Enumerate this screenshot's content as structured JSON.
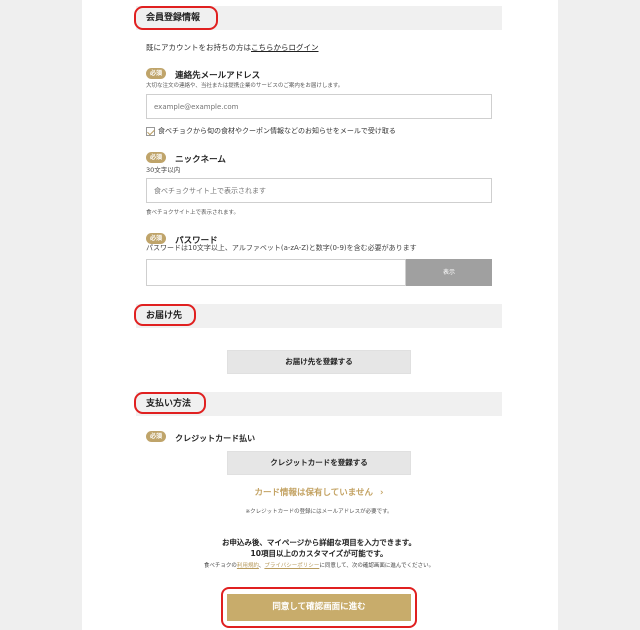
{
  "sections": {
    "member": "会員登録情報",
    "delivery": "お届け先",
    "payment": "支払い方法"
  },
  "login_prompt": {
    "text": "既にアカウントをお持ちの方は",
    "link": "こちらからログイン"
  },
  "required_label": "必須",
  "email": {
    "title": "連絡先メールアドレス",
    "description": "大切な注文の連絡や、当社または提携企業のサービスのご案内をお届けします。",
    "placeholder": "example@example.com",
    "newsletter": "食べチョクから旬の食材やクーポン情報などのお知らせをメールで受け取る"
  },
  "nickname": {
    "title": "ニックネーム",
    "limit": "30文字以内",
    "placeholder": "食べチョクサイト上で表示されます",
    "note": "食べチョクサイト上で表示されます。"
  },
  "password": {
    "title": "パスワード",
    "description": "パスワードは10文字以上、アルファベット(a-zA-Z)と数字(0-9)を含む必要があります",
    "show_button": "表示"
  },
  "delivery": {
    "register_button": "お届け先を登録する"
  },
  "payment": {
    "method": "クレジットカード払い",
    "register_button": "クレジットカードを登録する",
    "status": "カード情報は保有していません",
    "status_arrow": "›",
    "note": "※クレジットカードの登録にはメールアドレスが必要です。"
  },
  "footer": {
    "line1": "お申込み後、マイページから詳細な項目を入力できます。",
    "line2": "10項目以上のカスタマイズが可能です。",
    "terms_prefix": "食べチョクの",
    "terms_link": "利用規約",
    "terms_sep": "、",
    "privacy_link": "プライバシーポリシー",
    "terms_suffix": "に同意して、次の確認画面に進んでください。",
    "submit": "同意して確認画面に進む"
  },
  "colors": {
    "accent_gold": "#c8ac6b",
    "highlight_red": "#e02020",
    "badge": "#bfa46a"
  }
}
